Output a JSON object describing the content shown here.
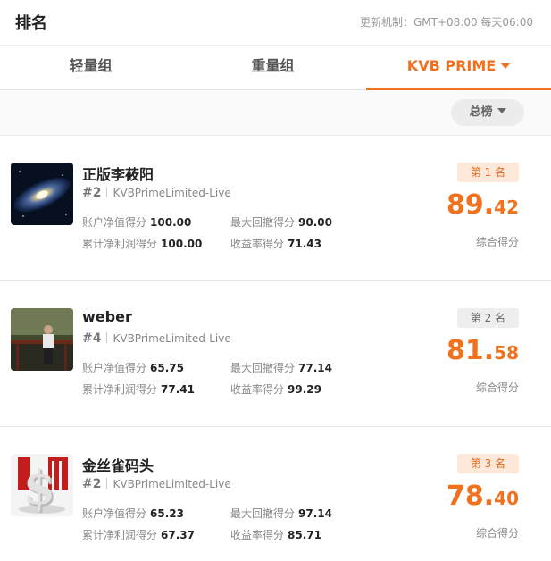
{
  "header": {
    "title": "排名",
    "update_info": "更新机制：GMT+08:00 每天06:00"
  },
  "tabs": [
    {
      "label": "轻量组",
      "active": false
    },
    {
      "label": "重量组",
      "active": false
    },
    {
      "label": "KVB PRIME",
      "active": true
    }
  ],
  "filter": {
    "label": "总榜"
  },
  "accent_color": "#f0711e",
  "score_caption": "综合得分",
  "entries": [
    {
      "name": "正版李莜阳",
      "rank": "#2",
      "account": "KVBPrimeLimited-Live",
      "place": "第 1 名",
      "score_int": "89",
      "score_dec": "42",
      "metrics": {
        "m1_label": "账户净值得分",
        "m1_value": "100.00",
        "m2_label": "最大回撤得分",
        "m2_value": "90.00",
        "m3_label": "累计净利润得分",
        "m3_value": "100.00",
        "m4_label": "收益率得分",
        "m4_value": "71.43"
      }
    },
    {
      "name": "weber",
      "rank": "#4",
      "account": "KVBPrimeLimited-Live",
      "place": "第 2 名",
      "score_int": "81",
      "score_dec": "58",
      "metrics": {
        "m1_label": "账户净值得分",
        "m1_value": "65.75",
        "m2_label": "最大回撤得分",
        "m2_value": "77.14",
        "m3_label": "累计净利润得分",
        "m3_value": "77.41",
        "m4_label": "收益率得分",
        "m4_value": "99.29"
      }
    },
    {
      "name": "金丝雀码头",
      "rank": "#2",
      "account": "KVBPrimeLimited-Live",
      "place": "第 3 名",
      "score_int": "78",
      "score_dec": "40",
      "metrics": {
        "m1_label": "账户净值得分",
        "m1_value": "65.23",
        "m2_label": "最大回撤得分",
        "m2_value": "97.14",
        "m3_label": "累计净利润得分",
        "m3_value": "67.37",
        "m4_label": "收益率得分",
        "m4_value": "85.71"
      }
    }
  ]
}
